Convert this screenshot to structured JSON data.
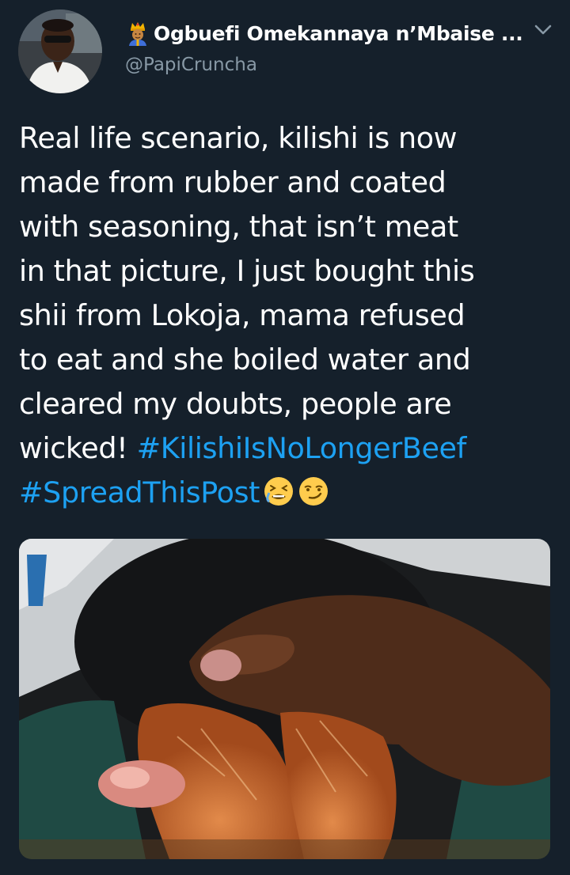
{
  "tweet": {
    "display_name": "Ogbuefi Omekannaya n’Mbaise ...",
    "handle": "@PapiCruncha",
    "text_lines": [
      "Real life scenario, kilishi is now",
      "made from rubber and coated",
      "with seasoning, that isn’t meat",
      "in that picture, I just bought this",
      "shii from Lokoja, mama refused",
      "to eat and she boiled water and",
      "cleared my doubts, people are"
    ],
    "last_line_prefix": "wicked! ",
    "hashtag_1": "#KilishiIsNoLongerBeef",
    "hashtag_2": "#SpreadThisPost",
    "name_emoji": "crown-prince-icon",
    "trailing_emojis": [
      "tired-face-icon",
      "smirking-face-icon"
    ]
  },
  "colors": {
    "background": "#15202b",
    "text": "#ffffff",
    "secondary": "#8899a6",
    "link": "#1da1f2"
  }
}
